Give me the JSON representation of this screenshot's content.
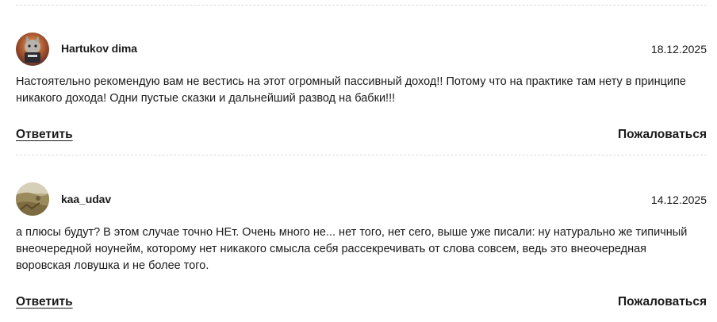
{
  "comments": [
    {
      "author": "Hartukov dima",
      "date": "18.12.2025",
      "text": "Настоятельно рекомендую вам не вестись на этот огромный пассивный доход!! Потому что на практике там нету в принципе никакого дохода! Одни пустые сказки и дальнейший развод на бабки!!!",
      "reply_label": "Ответить",
      "report_label": "Пожаловаться"
    },
    {
      "author": "kaa_udav",
      "date": "14.12.2025",
      "text": "а плюсы будут? В этом случае точно НЕт. Очень много не... нет того, нет сего, выше уже писали: ну натурально же типичный внеочередной ноунейм, которому нет никакого смысла себя рассекречивать от слова совсем, ведь это внеочередная воровская ловушка и не более того.",
      "reply_label": "Ответить",
      "report_label": "Пожаловаться"
    }
  ]
}
